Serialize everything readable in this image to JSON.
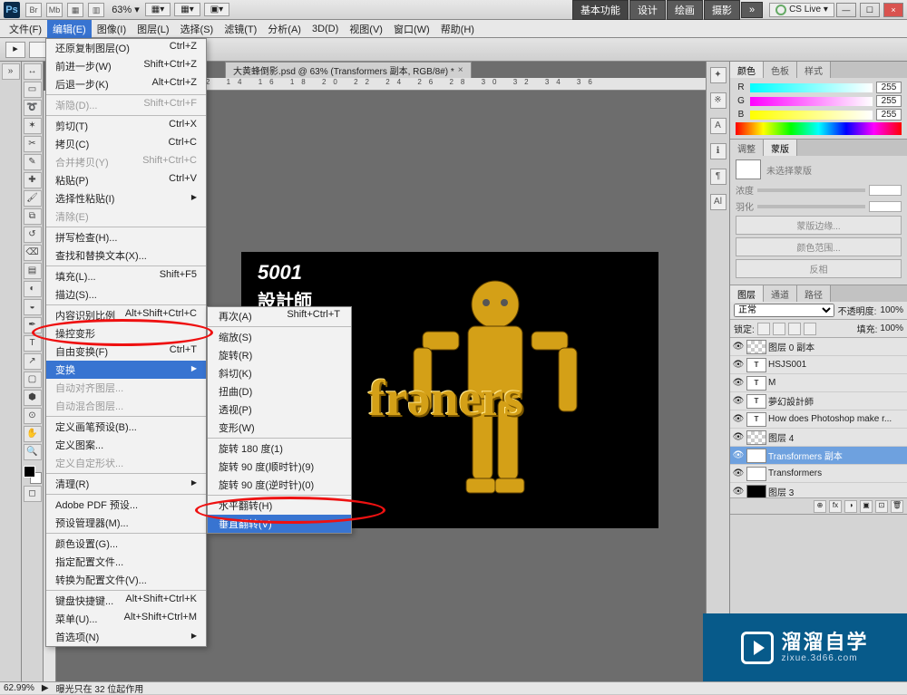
{
  "app": {
    "name": "Ps"
  },
  "top": {
    "icons": [
      "Br",
      "Mb",
      "▦",
      "▥"
    ],
    "zoom": "63% ▾",
    "drops": [
      "▦▾",
      "▦▾",
      "▣▾"
    ],
    "tabs": [
      "基本功能",
      "设计",
      "绘画",
      "摄影",
      "»"
    ],
    "cslive": "CS Live ▾",
    "win_min": "—",
    "win_max": "☐",
    "win_close": "×"
  },
  "menubar": [
    "文件(F)",
    "编辑(E)",
    "图像(I)",
    "图层(L)",
    "选择(S)",
    "滤镜(T)",
    "分析(A)",
    "3D(D)",
    "视图(V)",
    "窗口(W)",
    "帮助(H)"
  ],
  "doc_tab": {
    "title": "大黄蜂倒影.psd @ 63% (Transformers 副本, RGB/8#) *",
    "close": "×"
  },
  "ruler_marks": "0    2    4    6    8   10   12   14   16   18   20   22   24   26   28   30   32   34   36",
  "edit_menu": [
    {
      "label": "还原复制图层(O)",
      "sc": "Ctrl+Z"
    },
    {
      "label": "前进一步(W)",
      "sc": "Shift+Ctrl+Z"
    },
    {
      "label": "后退一步(K)",
      "sc": "Alt+Ctrl+Z"
    },
    {
      "sep": true
    },
    {
      "label": "渐隐(D)...",
      "sc": "Shift+Ctrl+F",
      "dis": true
    },
    {
      "sep": true
    },
    {
      "label": "剪切(T)",
      "sc": "Ctrl+X"
    },
    {
      "label": "拷贝(C)",
      "sc": "Ctrl+C"
    },
    {
      "label": "合并拷贝(Y)",
      "sc": "Shift+Ctrl+C",
      "dis": true
    },
    {
      "label": "粘贴(P)",
      "sc": "Ctrl+V"
    },
    {
      "label": "选择性粘贴(I)",
      "sub": true
    },
    {
      "label": "清除(E)",
      "dis": true
    },
    {
      "sep": true
    },
    {
      "label": "拼写检查(H)..."
    },
    {
      "label": "查找和替换文本(X)..."
    },
    {
      "sep": true
    },
    {
      "label": "填充(L)...",
      "sc": "Shift+F5"
    },
    {
      "label": "描边(S)..."
    },
    {
      "sep": true
    },
    {
      "label": "内容识别比例",
      "sc": "Alt+Shift+Ctrl+C"
    },
    {
      "label": "操控变形"
    },
    {
      "label": "自由变换(F)",
      "sc": "Ctrl+T"
    },
    {
      "label": "变换",
      "sub": true,
      "hov": true
    },
    {
      "label": "自动对齐图层...",
      "dis": true
    },
    {
      "label": "自动混合图层...",
      "dis": true
    },
    {
      "sep": true
    },
    {
      "label": "定义画笔预设(B)..."
    },
    {
      "label": "定义图案..."
    },
    {
      "label": "定义自定形状...",
      "dis": true
    },
    {
      "sep": true
    },
    {
      "label": "清理(R)",
      "sub": true
    },
    {
      "sep": true
    },
    {
      "label": "Adobe PDF 预设..."
    },
    {
      "label": "预设管理器(M)..."
    },
    {
      "sep": true
    },
    {
      "label": "颜色设置(G)..."
    },
    {
      "label": "指定配置文件..."
    },
    {
      "label": "转换为配置文件(V)..."
    },
    {
      "sep": true
    },
    {
      "label": "键盘快捷键...",
      "sc": "Alt+Shift+Ctrl+K"
    },
    {
      "label": "菜单(U)...",
      "sc": "Alt+Shift+Ctrl+M"
    },
    {
      "label": "首选项(N)",
      "sub": true
    }
  ],
  "transform_submenu": [
    {
      "label": "再次(A)",
      "sc": "Shift+Ctrl+T"
    },
    {
      "sep": true
    },
    {
      "label": "缩放(S)"
    },
    {
      "label": "旋转(R)"
    },
    {
      "label": "斜切(K)"
    },
    {
      "label": "扭曲(D)"
    },
    {
      "label": "透视(P)"
    },
    {
      "label": "变形(W)"
    },
    {
      "sep": true
    },
    {
      "label": "旋转 180 度(1)"
    },
    {
      "label": "旋转 90 度(顺时针)(9)"
    },
    {
      "label": "旋转 90 度(逆时针)(0)"
    },
    {
      "sep": true
    },
    {
      "label": "水平翻转(H)"
    },
    {
      "label": "垂直翻转(V)",
      "hov": true
    }
  ],
  "canvas_text": {
    "code": "5001",
    "designer": "設計師",
    "brand": "frəners"
  },
  "right_icons": [
    "✦",
    "※",
    "A",
    "ℹ",
    "¶",
    "Al"
  ],
  "color_panel": {
    "tabs": [
      "颜色",
      "色板",
      "样式"
    ],
    "R": "255",
    "G": "255",
    "B": "255"
  },
  "adjust_tabs": [
    "调整",
    "蒙版"
  ],
  "mask": {
    "title": "未选择蒙版",
    "density": "浓度",
    "density_val": "",
    "feather": "羽化",
    "feather_val": "",
    "btn1": "蒙版边缘...",
    "btn2": "颜色范围...",
    "btn3": "反相"
  },
  "layer_panel": {
    "tabs": [
      "图层",
      "通道",
      "路径"
    ],
    "blend": "正常",
    "opacity_label": "不透明度:",
    "opacity": "100%",
    "lock_label": "锁定:",
    "fill_label": "填充:",
    "fill": "100%",
    "layers": [
      {
        "thumb": "check",
        "name": "图层 0 副本"
      },
      {
        "thumb": "T",
        "name": "HSJS001"
      },
      {
        "thumb": "T",
        "name": "M"
      },
      {
        "thumb": "T",
        "name": "夢幻設計師"
      },
      {
        "thumb": "T",
        "name": "How does Photoshop make r..."
      },
      {
        "thumb": "check",
        "name": "图层 4"
      },
      {
        "thumb": "img",
        "name": "Transformers 副本",
        "sel": true
      },
      {
        "thumb": "img",
        "name": "Transformers"
      },
      {
        "thumb": "black",
        "name": "图层 3"
      }
    ],
    "footer_icons": [
      "⊕",
      "fx",
      "◑",
      "▣",
      "⊡",
      "🗑"
    ]
  },
  "status": {
    "zoom": "62.99%",
    "info": "曝光只在 32 位起作用"
  },
  "watermark": {
    "big": "溜溜自学",
    "small": "zixue.3d66.com"
  }
}
